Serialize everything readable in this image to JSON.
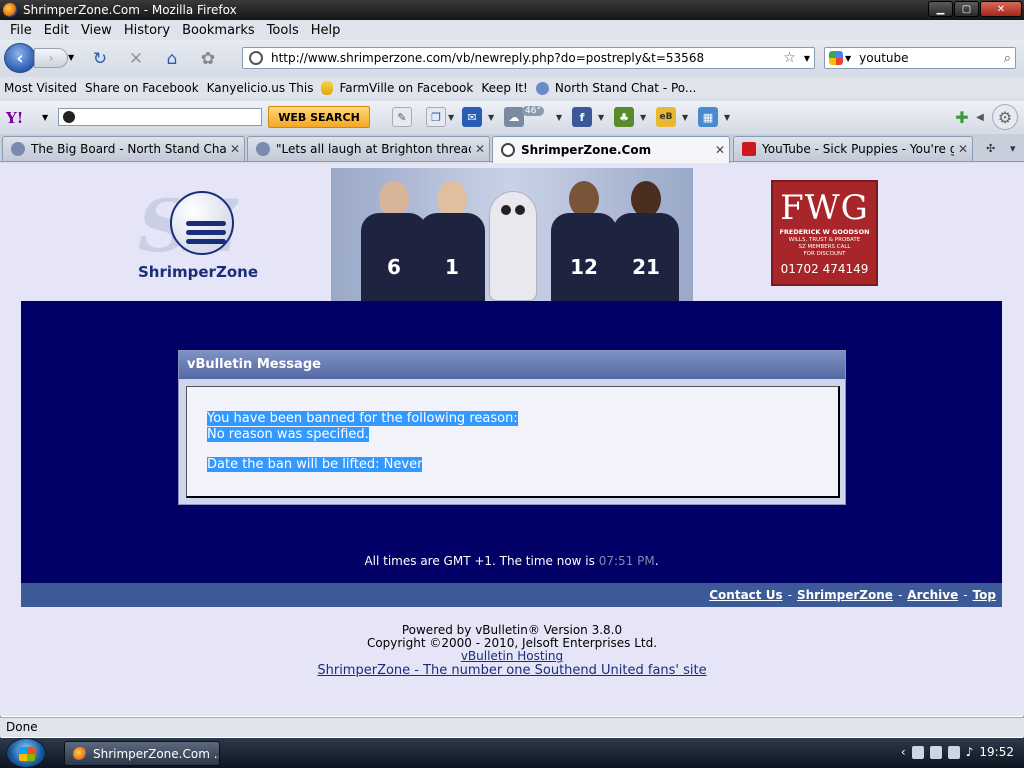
{
  "window": {
    "title": "ShrimperZone.Com - Mozilla Firefox"
  },
  "menu": [
    "File",
    "Edit",
    "View",
    "History",
    "Bookmarks",
    "Tools",
    "Help"
  ],
  "nav": {
    "url": "http://www.shrimperzone.com/vb/newreply.php?do=postreply&t=53568",
    "search_query": "youtube"
  },
  "bookmarks": [
    "Most Visited",
    "Share on Facebook",
    "Kanyelicio.us This",
    "FarmVille on Facebook",
    "Keep It!",
    "North Stand Chat - Po..."
  ],
  "yahoo_toolbar": {
    "logo": "Y!",
    "search_button": "WEB SEARCH",
    "weather": "46°"
  },
  "tabs": [
    {
      "label": "The Big Board - North Stand Chat",
      "active": false
    },
    {
      "label": "\"Lets all laugh at Brighton thread\" ...",
      "active": false
    },
    {
      "label": "ShrimperZone.Com",
      "active": true
    },
    {
      "label": "YouTube - Sick Puppies - You're g...",
      "active": false
    }
  ],
  "header": {
    "logo_letters": "SZ",
    "logo_name": "ShrimperZone",
    "shirt_numbers": [
      "6",
      "1",
      "12",
      "21"
    ],
    "ad": {
      "title": "FWG",
      "name": "FREDERICK W GOODSON",
      "lines": [
        "WILLS, TRUST & PROBATE",
        "SZ MEMBERS CALL",
        "FOR DISCOUNT"
      ],
      "phone": "01702 474149"
    }
  },
  "message": {
    "title": "vBulletin Message",
    "line1": "You have been banned for the following reason:",
    "line2": "No reason was specified.",
    "line3": "Date the ban will be lifted: Never"
  },
  "times": {
    "prefix": "All times are GMT +1. The time now is",
    "time": "07:51 PM",
    "suffix": "."
  },
  "footer": {
    "links": [
      "Contact Us",
      "ShrimperZone",
      "Archive",
      "Top"
    ],
    "separator": "-",
    "powered": "Powered by vBulletin® Version 3.8.0",
    "copyright": "Copyright ©2000 - 2010, Jelsoft Enterprises Ltd.",
    "hosting": "vBulletin Hosting",
    "site_link": "ShrimperZone - The number one Southend United fans' site"
  },
  "status": {
    "text": "Done"
  },
  "taskbar": {
    "task_label": "ShrimperZone.Com ...",
    "clock": "19:52"
  }
}
